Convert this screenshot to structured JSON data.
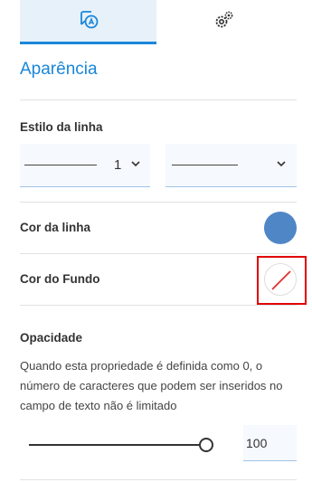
{
  "tabs": {
    "appearance_icon": "appearance-icon",
    "settings_icon": "gear-icon"
  },
  "panel": {
    "title": "Aparência"
  },
  "line_style": {
    "label": "Estilo da linha",
    "width_value": "1"
  },
  "line_color": {
    "label": "Cor da linha",
    "color": "#4f86c6"
  },
  "fill_color": {
    "label": "Cor do Fundo",
    "value": "none"
  },
  "opacity": {
    "label": "Opacidade",
    "description": "Quando esta propriedade é definida como 0, o número de caracteres que podem ser inseridos no campo de texto não é limitado",
    "value": "100",
    "level_percent": 100
  },
  "colors": {
    "accent": "#1a86d9",
    "highlight": "#e00000"
  }
}
